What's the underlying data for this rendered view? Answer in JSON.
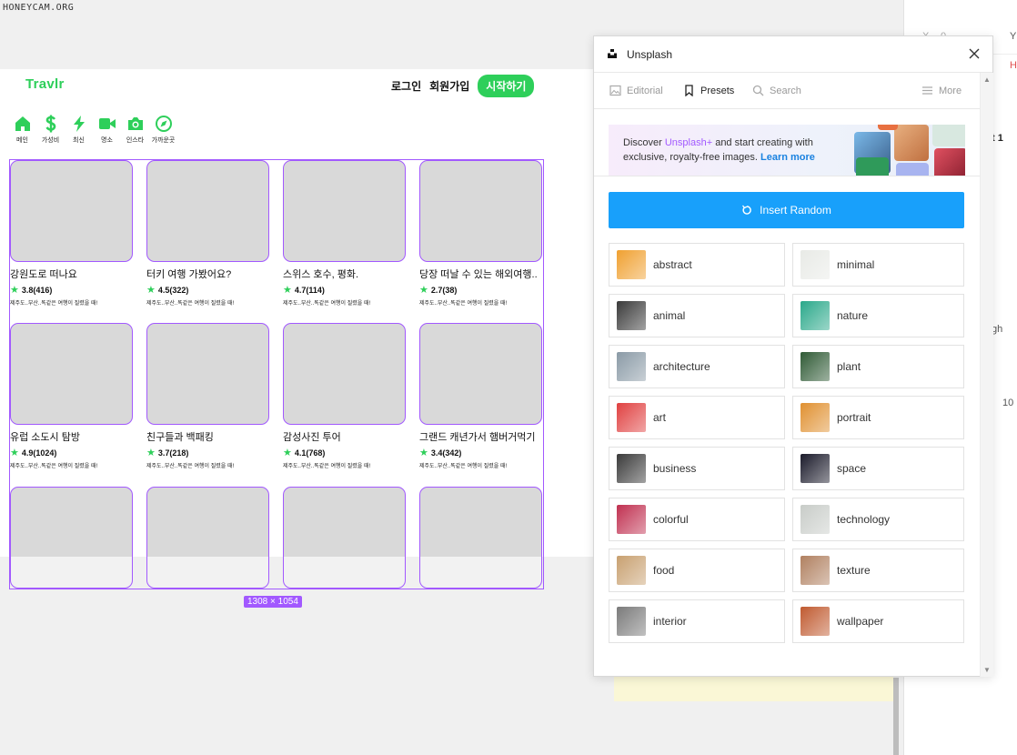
{
  "watermark": "HONEYCAM.ORG",
  "inspector": {
    "x_label": "X",
    "x_value": "0",
    "y_label": "Y",
    "h_label": "H",
    "frame_label": "t 1",
    "g_label": "gh",
    "num_value": "10"
  },
  "app": {
    "brand": "Travlr",
    "nav": {
      "login": "로그인",
      "signup": "회원가입",
      "start": "시작하기"
    },
    "brand_color": "#2ecf5a",
    "categories": [
      {
        "label": "메인",
        "icon": "home-icon"
      },
      {
        "label": "가성비",
        "icon": "dollar-icon"
      },
      {
        "label": "최신",
        "icon": "lightning-icon"
      },
      {
        "label": "명소",
        "icon": "video-camera-icon"
      },
      {
        "label": "인스타",
        "icon": "camera-icon"
      },
      {
        "label": "가까운곳",
        "icon": "compass-icon"
      }
    ],
    "cards": [
      {
        "title": "강원도로 떠나요",
        "rating": "3.8(416)",
        "desc": "제주도..부산..똑같은 여행이 질렸을 때!"
      },
      {
        "title": "터키 여행 가봤어요?",
        "rating": "4.5(322)",
        "desc": "제주도..부산..똑같은 여행이 질렸을 때!"
      },
      {
        "title": "스위스 호수, 평화.",
        "rating": "4.7(114)",
        "desc": "제주도..부산..똑같은 여행이 질렸을 때!"
      },
      {
        "title": "당장 떠날 수 있는 해외여행..",
        "rating": "2.7(38)",
        "desc": "제주도..부산..똑같은 여행이 질렸을 때!"
      },
      {
        "title": "유럽 소도시 탐방",
        "rating": "4.9(1024)",
        "desc": "제주도..부산..똑같은 여행이 질렸을 때!"
      },
      {
        "title": "친구들과 백패킹",
        "rating": "3.7(218)",
        "desc": "제주도..부산..똑같은 여행이 질렸을 때!"
      },
      {
        "title": "감성사진 투어",
        "rating": "4.1(768)",
        "desc": "제주도..부산..똑같은 여행이 질렸을 때!"
      },
      {
        "title": "그랜드 캐년가서 햄버거먹기",
        "rating": "3.4(342)",
        "desc": "제주도..부산..똑같은 여행이 질렸을 때!"
      }
    ],
    "selection_size": "1308 × 1054",
    "selection_color": "#a259ff"
  },
  "plugin": {
    "title": "Unsplash",
    "tabs": [
      {
        "label": "Editorial",
        "icon": "image-icon"
      },
      {
        "label": "Presets",
        "icon": "bookmark-icon"
      },
      {
        "label": "Search",
        "icon": "search-icon"
      },
      {
        "label": "More",
        "icon": "hamburger-menu-icon"
      }
    ],
    "active_tab": "Presets",
    "promo": {
      "prefix": "Discover ",
      "highlight": "Unsplash+",
      "middle": " and start creating with exclusive, royalty-free images. ",
      "link": "Learn more"
    },
    "insert_random": "Insert Random",
    "accent_color": "#18a0fb",
    "presets": [
      {
        "label": "abstract",
        "color": "#f0a030"
      },
      {
        "label": "minimal",
        "color": "#e8eae6"
      },
      {
        "label": "animal",
        "color": "#3a3a3a"
      },
      {
        "label": "nature",
        "color": "#2aa88a"
      },
      {
        "label": "architecture",
        "color": "#8a9aa6"
      },
      {
        "label": "plant",
        "color": "#2f5a35"
      },
      {
        "label": "art",
        "color": "#e04040"
      },
      {
        "label": "portrait",
        "color": "#e09030"
      },
      {
        "label": "business",
        "color": "#3a3a3a"
      },
      {
        "label": "space",
        "color": "#1a1a2a"
      },
      {
        "label": "colorful",
        "color": "#c03050"
      },
      {
        "label": "technology",
        "color": "#c8ccc8"
      },
      {
        "label": "food",
        "color": "#c8a070"
      },
      {
        "label": "texture",
        "color": "#b08060"
      },
      {
        "label": "interior",
        "color": "#7a7a7a"
      },
      {
        "label": "wallpaper",
        "color": "#c05a30"
      }
    ]
  }
}
